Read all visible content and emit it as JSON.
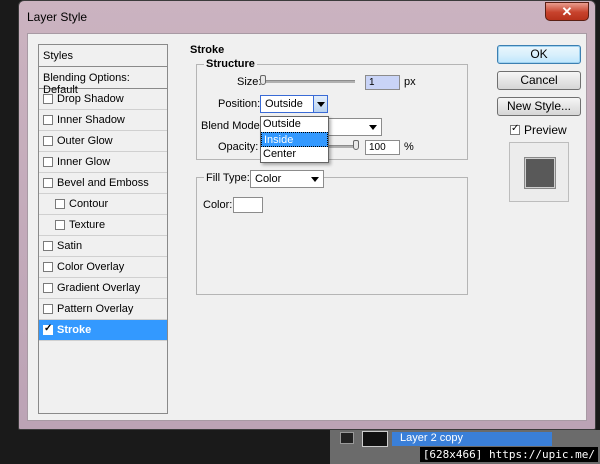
{
  "window": {
    "title": "Layer Style",
    "close_glyph": "✕"
  },
  "background": {
    "layer_name": "Layer 2 copy",
    "watermark": "[628x466] https://upic.me/"
  },
  "styles_list": {
    "header": "Styles",
    "blending": "Blending Options: Default",
    "items": [
      {
        "label": "Drop Shadow",
        "checked": false,
        "sub": false
      },
      {
        "label": "Inner Shadow",
        "checked": false,
        "sub": false
      },
      {
        "label": "Outer Glow",
        "checked": false,
        "sub": false
      },
      {
        "label": "Inner Glow",
        "checked": false,
        "sub": false
      },
      {
        "label": "Bevel and Emboss",
        "checked": false,
        "sub": false
      },
      {
        "label": "Contour",
        "checked": false,
        "sub": true
      },
      {
        "label": "Texture",
        "checked": false,
        "sub": true
      },
      {
        "label": "Satin",
        "checked": false,
        "sub": false
      },
      {
        "label": "Color Overlay",
        "checked": false,
        "sub": false
      },
      {
        "label": "Gradient Overlay",
        "checked": false,
        "sub": false
      },
      {
        "label": "Pattern Overlay",
        "checked": false,
        "sub": false
      },
      {
        "label": "Stroke",
        "checked": true,
        "sub": false,
        "selected": true
      }
    ]
  },
  "stroke": {
    "group_title": "Stroke",
    "structure_title": "Structure",
    "size_label": "Size:",
    "size_value": "1",
    "size_unit": "px",
    "position_label": "Position:",
    "position_value": "Outside",
    "position_options": [
      "Outside",
      "Inside",
      "Center"
    ],
    "position_hover": "Inside",
    "blend_label": "Blend Mode:",
    "opacity_label": "Opacity:",
    "opacity_value": "100",
    "opacity_unit": "%",
    "fill_type_label": "Fill Type:",
    "fill_type_value": "Color",
    "color_label": "Color:",
    "color_value": "#ffffff"
  },
  "buttons": {
    "ok": "OK",
    "cancel": "Cancel",
    "new_style": "New Style...",
    "preview": "Preview",
    "preview_checked": true
  },
  "colors": {
    "selection": "#3399ff",
    "preview_swatch": "#595959"
  }
}
